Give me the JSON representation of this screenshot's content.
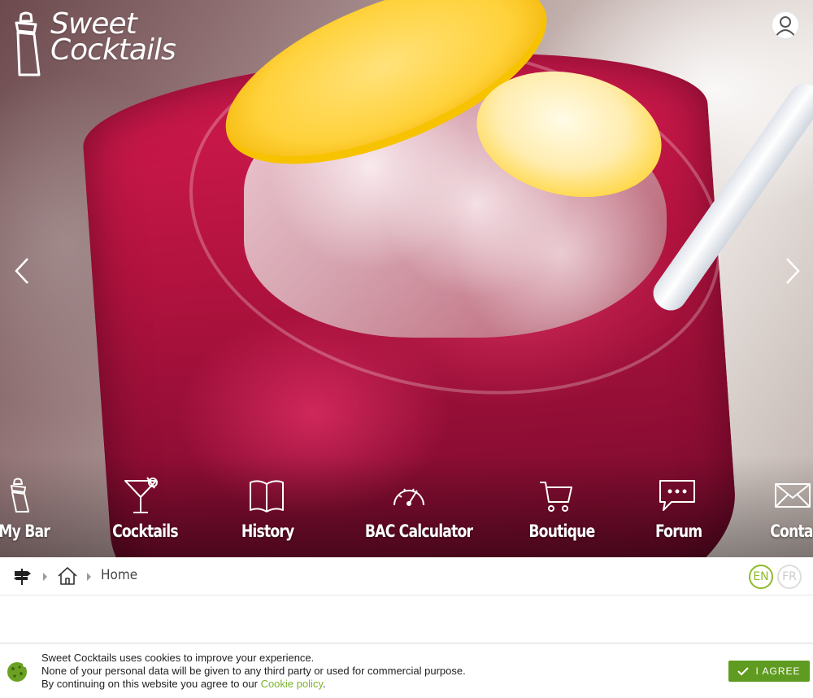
{
  "brand": {
    "line1": "Sweet",
    "line2": "Cocktails"
  },
  "icons": {
    "logo": "cocktail-shaker-icon",
    "user": "user-avatar-icon",
    "prev": "chevron-left-icon",
    "next": "chevron-right-icon"
  },
  "nav": {
    "items": [
      {
        "label": "My Bar",
        "icon": "shaker-icon"
      },
      {
        "label": "Cocktails",
        "icon": "martini-glass-icon"
      },
      {
        "label": "History",
        "icon": "open-book-icon"
      },
      {
        "label": "BAC Calculator",
        "icon": "speedometer-icon"
      },
      {
        "label": "Boutique",
        "icon": "shopping-cart-icon"
      },
      {
        "label": "Forum",
        "icon": "chat-bubble-icon"
      },
      {
        "label": "Contac",
        "icon": "envelope-icon"
      }
    ]
  },
  "breadcrumb": {
    "current": "Home"
  },
  "languages": {
    "en": "EN",
    "fr": "FR",
    "active": "EN"
  },
  "cookie": {
    "line1": "Sweet Cocktails uses cookies to improve your experience.",
    "line2": "None of your personal data will be given to any third party or used for commercial purpose.",
    "line3_prefix": "By continuing on this website you agree to our ",
    "link": "Cookie policy",
    "line3_suffix": ".",
    "agree": "I AGREE"
  },
  "colors": {
    "accent": "#8dbb2b",
    "agree_button": "#5f9b20",
    "cookie_link": "#7bb42a"
  }
}
